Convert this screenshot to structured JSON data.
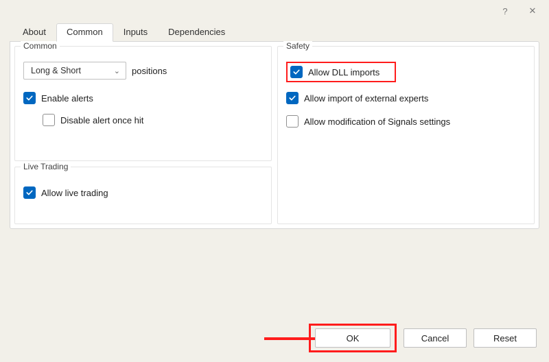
{
  "titlebar": {
    "help": "?",
    "close": "✕"
  },
  "tabs": {
    "about": "About",
    "common": "Common",
    "inputs": "Inputs",
    "dependencies": "Dependencies",
    "active": "common"
  },
  "common_group": {
    "legend": "Common",
    "positions_select": "Long & Short",
    "positions_label": "positions",
    "enable_alerts": "Enable alerts",
    "disable_alert_once": "Disable alert once hit"
  },
  "live_trading_group": {
    "legend": "Live Trading",
    "allow_live_trading": "Allow live trading"
  },
  "safety_group": {
    "legend": "Safety",
    "allow_dll": "Allow DLL imports",
    "allow_ext_experts": "Allow import of external experts",
    "allow_mod_signals": "Allow modification of Signals settings"
  },
  "buttons": {
    "ok": "OK",
    "cancel": "Cancel",
    "reset": "Reset"
  }
}
